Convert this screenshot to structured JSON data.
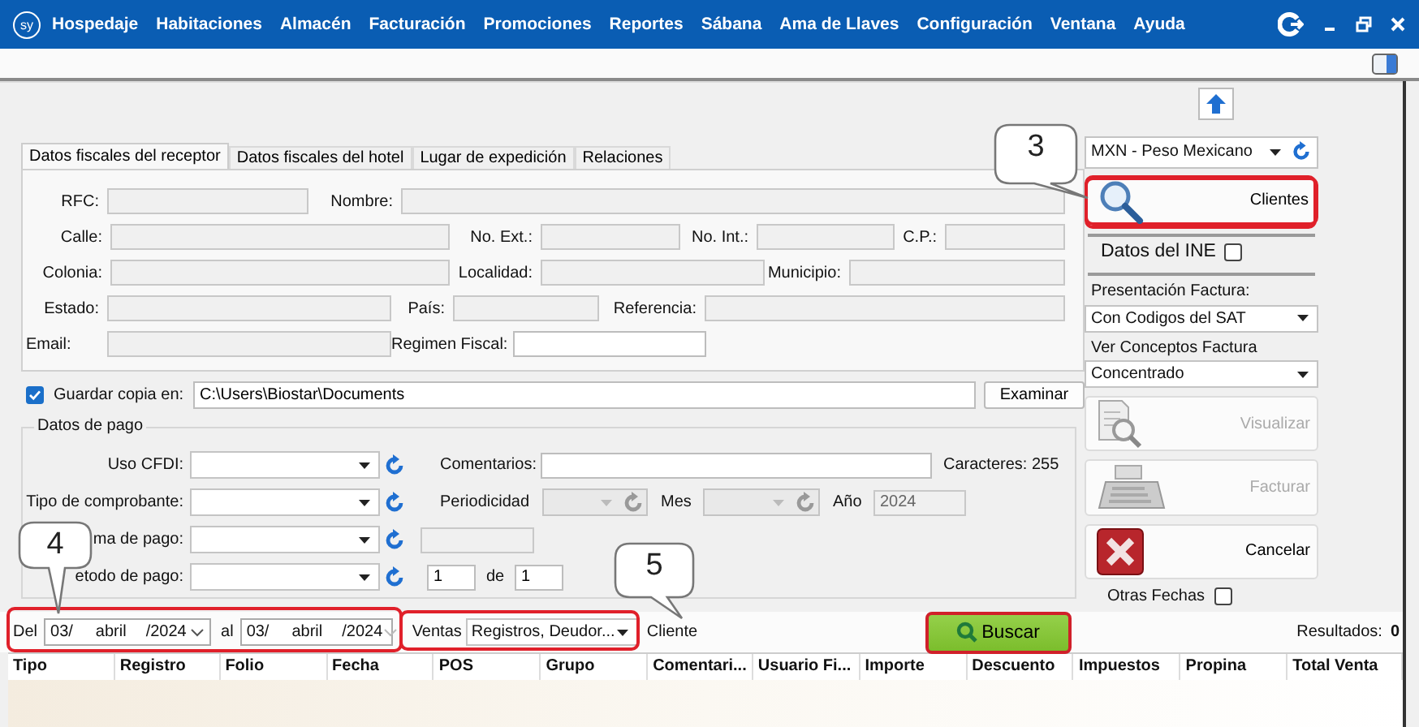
{
  "menu": {
    "logo": "sy",
    "items": [
      "Hospedaje",
      "Habitaciones",
      "Almacén",
      "Facturación",
      "Promociones",
      "Reportes",
      "Sábana",
      "Ama de Llaves",
      "Configuración",
      "Ventana",
      "Ayuda"
    ]
  },
  "tabs": [
    {
      "label": "Datos fiscales del receptor",
      "selected": true
    },
    {
      "label": "Datos fiscales del hotel",
      "selected": false
    },
    {
      "label": "Lugar de expedición",
      "selected": false
    },
    {
      "label": "Relaciones",
      "selected": false
    }
  ],
  "receptor": {
    "rows": [
      {
        "fields": [
          {
            "label": "RFC:",
            "disabled": true
          },
          {
            "label": "Nombre:",
            "disabled": true
          }
        ]
      },
      {
        "fields": [
          {
            "label": "Calle:",
            "disabled": true
          },
          {
            "label": "No. Ext.:",
            "disabled": true
          },
          {
            "label": "No. Int.:",
            "disabled": true
          },
          {
            "label": "C.P.:",
            "disabled": true
          }
        ]
      },
      {
        "fields": [
          {
            "label": "Colonia:",
            "disabled": true
          },
          {
            "label": "Localidad:",
            "disabled": true
          },
          {
            "label": "Municipio:",
            "disabled": true
          }
        ]
      },
      {
        "fields": [
          {
            "label": "Estado:",
            "disabled": true
          },
          {
            "label": "País:",
            "disabled": true
          },
          {
            "label": "Referencia:",
            "disabled": true
          }
        ]
      },
      {
        "fields": [
          {
            "label": "Email:",
            "disabled": true
          },
          {
            "label": "Regimen Fiscal:",
            "disabled": false
          }
        ]
      }
    ]
  },
  "guardar_copia": {
    "label": "Guardar copia en:",
    "checked": true,
    "value": "C:\\Users\\Biostar\\Documents",
    "button": "Examinar"
  },
  "datos_de_pago": {
    "title": "Datos de pago",
    "rows": [
      {
        "items": [
          {
            "kind": "combo",
            "label": "Uso CFDI:",
            "disabled": false
          },
          {
            "kind": "field",
            "label": "Comentarios:",
            "disabled": false
          },
          {
            "kind": "note",
            "text": "Caracteres: 255"
          }
        ]
      },
      {
        "items": [
          {
            "kind": "combo",
            "label": "Tipo de comprobante:",
            "disabled": false
          },
          {
            "kind": "combo",
            "label": "Periodicidad",
            "disabled": true
          },
          {
            "kind": "combo",
            "label": "Mes",
            "disabled": true
          },
          {
            "kind": "field",
            "label": "Año",
            "value": "2024",
            "disabled": true
          }
        ]
      },
      {
        "items": [
          {
            "kind": "combo",
            "label": "ma de pago:",
            "disabled": false
          },
          {
            "kind": "field",
            "disabled": true
          }
        ]
      },
      {
        "items": [
          {
            "kind": "combo",
            "label": "etodo de pago:",
            "disabled": false
          },
          {
            "kind": "field",
            "value": "1",
            "disabled": false
          },
          {
            "kind": "field",
            "label": "de",
            "value": "1",
            "disabled": false
          }
        ]
      }
    ]
  },
  "side": {
    "currency": "MXN - Peso Mexicano",
    "clientes": "Clientes",
    "ine": {
      "label": "Datos del INE",
      "checked": false
    },
    "presentacion": {
      "label": "Presentación Factura:",
      "value": "Con Codigos del SAT"
    },
    "conceptos": {
      "label": "Ver Conceptos Factura",
      "value": "Concentrado"
    },
    "actions": [
      {
        "kind": "visualizar",
        "label": "Visualizar",
        "disabled": true
      },
      {
        "kind": "facturar",
        "label": "Facturar",
        "disabled": true
      },
      {
        "kind": "cancelar",
        "label": "Cancelar",
        "disabled": false
      }
    ],
    "otras_fechas": {
      "label": "Otras Fechas",
      "checked": false
    }
  },
  "filter": {
    "del": "Del",
    "from": {
      "day": "03/",
      "month": "abril",
      "year": "/2024"
    },
    "al": "al",
    "to": {
      "day": "03/",
      "month": "abril",
      "year": "/2024"
    },
    "ventas": "Ventas",
    "ventas_value": "Registros, Deudor...",
    "cliente": "Cliente",
    "buscar": "Buscar",
    "resultados": "Resultados:",
    "count": "0"
  },
  "table": {
    "columns": [
      "Tipo",
      "Registro",
      "Folio",
      "Fecha",
      "POS",
      "Grupo",
      "Comentari...",
      "Usuario Fi...",
      "Importe",
      "Descuento",
      "Impuestos",
      "Propina",
      "Total Venta"
    ]
  },
  "callouts": [
    {
      "number": "3"
    },
    {
      "number": "4"
    },
    {
      "number": "5"
    }
  ]
}
